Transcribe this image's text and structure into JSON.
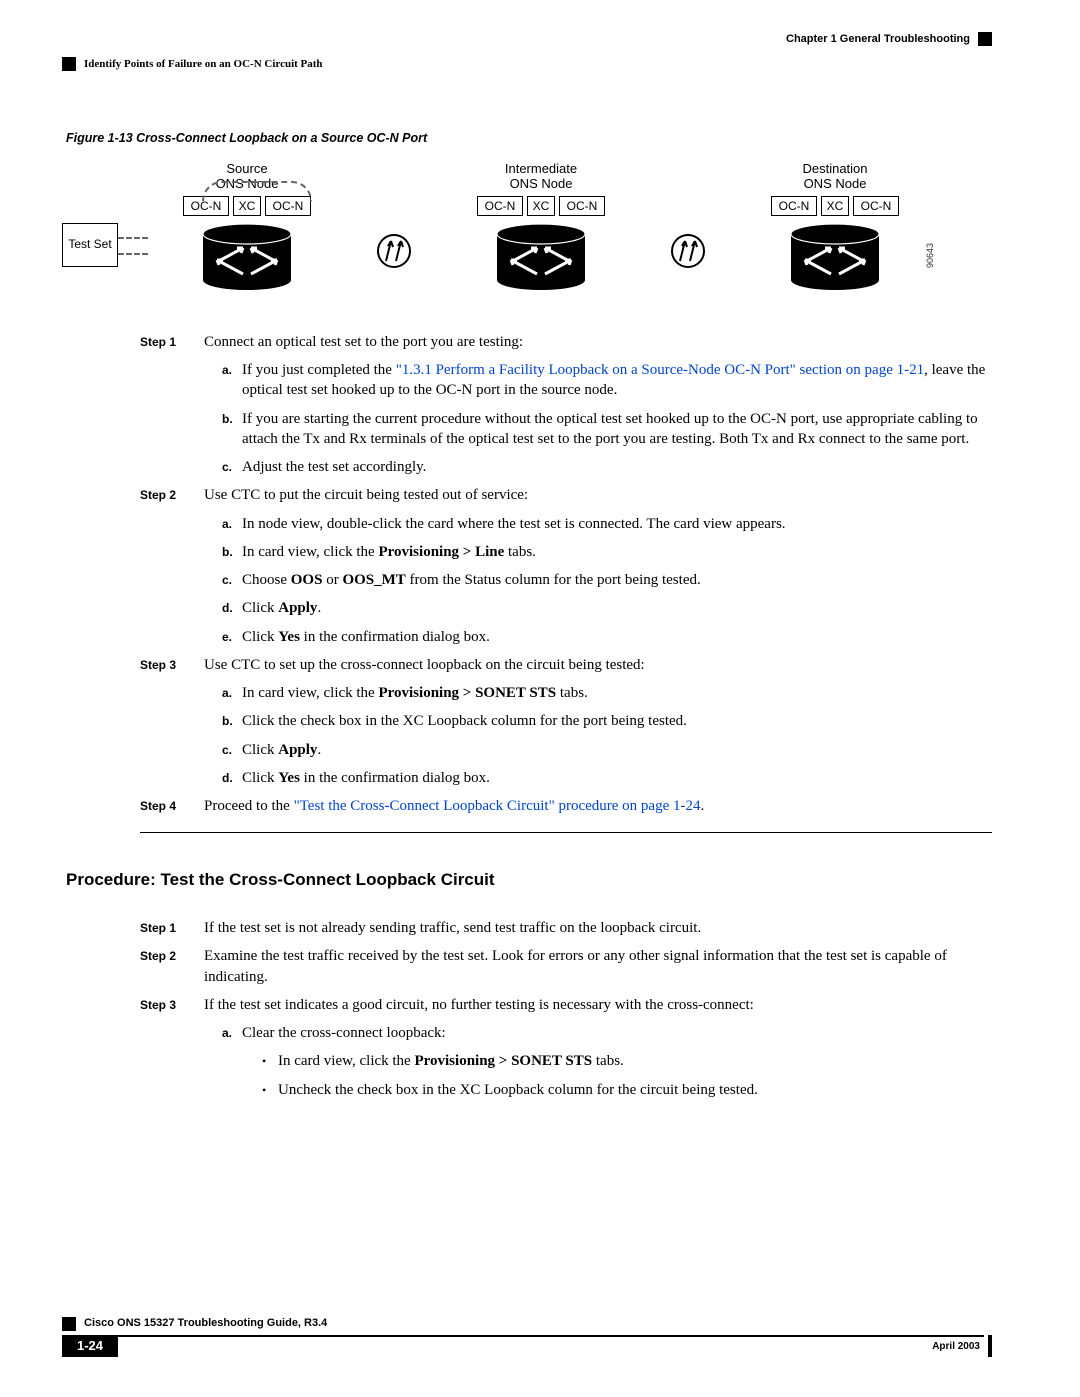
{
  "header": {
    "chapter": "Chapter 1      General Troubleshooting",
    "section": "Identify Points of Failure on an OC-N Circuit Path"
  },
  "figure": {
    "caption": "Figure 1-13   Cross-Connect Loopback on a Source OC-N Port",
    "testset": "Test Set",
    "node_source": "Source\nONS Node",
    "node_intermediate": "Intermediate\nONS Node",
    "node_destination": "Destination\nONS Node",
    "ocn": "OC-N",
    "xc": "XC",
    "id": "90643"
  },
  "steps1": {
    "s1": {
      "label": "Step 1",
      "text": "Connect an optical test set to the port you are testing:",
      "a_pre": "If you just completed the ",
      "a_link": "\"1.3.1 Perform a Facility Loopback on a Source-Node OC-N Port\" section on page 1-21",
      "a_post": ", leave the optical test set hooked up to the OC-N port in the source node.",
      "b": "If you are starting the current procedure without the optical test set hooked up to the OC-N port, use appropriate cabling to attach the Tx and Rx terminals of the optical test set to the port you are testing. Both Tx and Rx connect to the same port.",
      "c": "Adjust the test set accordingly."
    },
    "s2": {
      "label": "Step 2",
      "text": "Use CTC to put the circuit being tested out of service:",
      "a": "In node view, double-click the card where the test set is connected. The card view appears.",
      "b_pre": "In card view, click the ",
      "b_bold": "Provisioning > Line",
      "b_post": " tabs.",
      "c_pre": "Choose ",
      "c_b1": "OOS",
      "c_m": " or ",
      "c_b2": "OOS_MT",
      "c_post": " from the Status column for the port being tested.",
      "d_pre": "Click ",
      "d_bold": "Apply",
      "d_post": ".",
      "e_pre": "Click ",
      "e_bold": "Yes",
      "e_post": " in the confirmation dialog box."
    },
    "s3": {
      "label": "Step 3",
      "text": "Use CTC to set up the cross-connect loopback on the circuit being tested:",
      "a_pre": "In card view, click the ",
      "a_bold": "Provisioning > SONET STS",
      "a_post": " tabs.",
      "b": "Click the check box in the XC Loopback column for the port being tested.",
      "c_pre": "Click ",
      "c_bold": "Apply",
      "c_post": ".",
      "d_pre": "Click ",
      "d_bold": "Yes",
      "d_post": " in the confirmation dialog box."
    },
    "s4": {
      "label": "Step 4",
      "text_pre": "Proceed to the ",
      "text_link": "\"Test the Cross-Connect Loopback Circuit\" procedure on page 1-24",
      "text_post": "."
    }
  },
  "procedure_heading": "Procedure: Test the Cross-Connect Loopback Circuit",
  "steps2": {
    "s1": {
      "label": "Step 1",
      "text": "If the test set is not already sending traffic, send test traffic on the loopback circuit."
    },
    "s2": {
      "label": "Step 2",
      "text": "Examine the test traffic received by the test set. Look for errors or any other signal information that the test set is capable of indicating."
    },
    "s3": {
      "label": "Step 3",
      "text": "If the test set indicates a good circuit, no further testing is necessary with the cross-connect:",
      "a": "Clear the cross-connect loopback:",
      "bul1_pre": "In card view, click the ",
      "bul1_bold": "Provisioning > SONET STS",
      "bul1_post": " tabs.",
      "bul2": "Uncheck the check box in the XC Loopback column for the circuit being tested."
    }
  },
  "footer": {
    "book": "Cisco ONS 15327 Troubleshooting Guide, R3.4",
    "page": "1-24",
    "date": "April 2003"
  }
}
